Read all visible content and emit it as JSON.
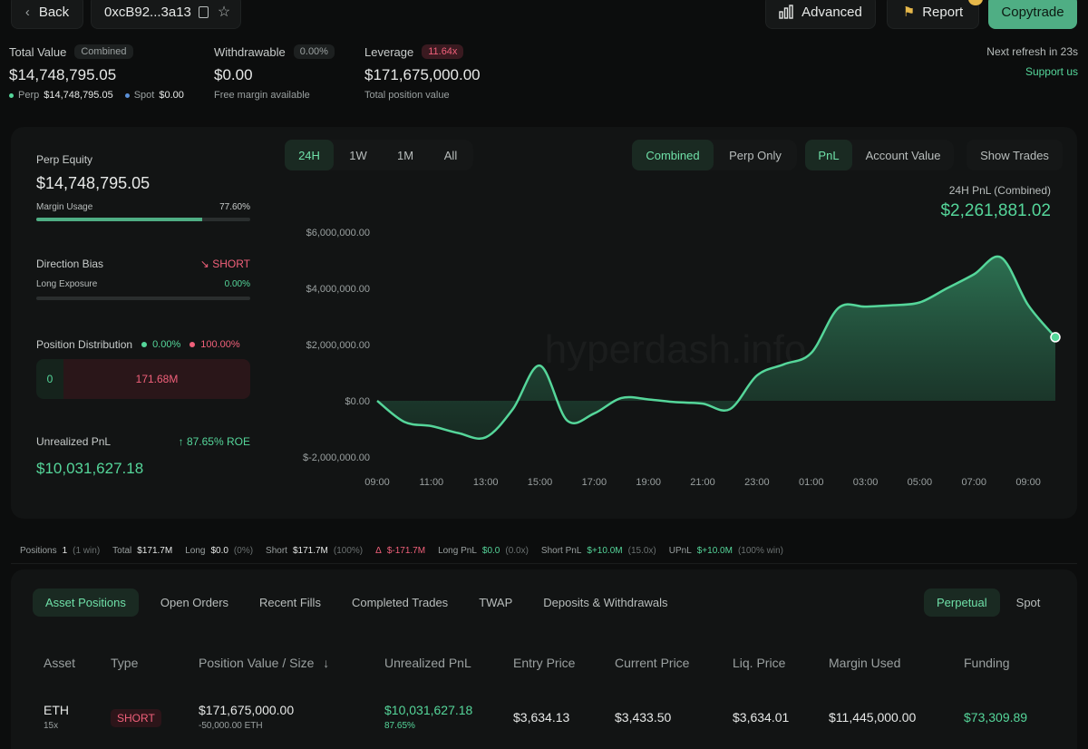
{
  "header": {
    "back_label": "Back",
    "address": "0xcB92...3a13",
    "advanced_label": "Advanced",
    "report_label": "Report",
    "copytrade_label": "Copytrade"
  },
  "summary": {
    "total_value_label": "Total Value",
    "total_value_badge": "Combined",
    "total_value": "$14,748,795.05",
    "perp_label": "Perp",
    "perp_value": "$14,748,795.05",
    "spot_label": "Spot",
    "spot_value": "$0.00",
    "withdrawable_label": "Withdrawable",
    "withdrawable_badge": "0.00%",
    "withdrawable_value": "$0.00",
    "withdrawable_sub": "Free margin available",
    "leverage_label": "Leverage",
    "leverage_badge": "11.64x",
    "leverage_value": "$171,675,000.00",
    "leverage_sub": "Total position value",
    "next_refresh": "Next refresh in 23s",
    "support": "Support us"
  },
  "left": {
    "perp_equity_label": "Perp Equity",
    "perp_equity_value": "$14,748,795.05",
    "margin_usage_label": "Margin Usage",
    "margin_usage_value": "77.60%",
    "margin_usage_fraction": 0.776,
    "direction_bias_label": "Direction Bias",
    "direction_bias_value": "SHORT",
    "long_exposure_label": "Long Exposure",
    "long_exposure_value": "0.00%",
    "long_exposure_fraction": 0.0,
    "position_distribution_label": "Position Distribution",
    "dist_long_pct": "0.00%",
    "dist_short_pct": "100.00%",
    "dist_long_value": "0",
    "dist_short_value": "171.68M",
    "unrealized_label": "Unrealized PnL",
    "roe": "87.65% ROE",
    "unrealized_value": "$10,031,627.18"
  },
  "chart_controls": {
    "ranges": [
      "24H",
      "1W",
      "1M",
      "All"
    ],
    "active_range": "24H",
    "modes": [
      "Combined",
      "Perp Only"
    ],
    "metrics": [
      "PnL",
      "Account Value"
    ],
    "show_trades": "Show Trades",
    "pnl_label": "24H PnL (Combined)",
    "pnl_value": "$2,261,881.02",
    "watermark": "hyperdash.info"
  },
  "chart_data": {
    "type": "area",
    "x": [
      "09:00",
      "10:00",
      "11:00",
      "12:00",
      "13:00",
      "14:00",
      "15:00",
      "16:00",
      "17:00",
      "18:00",
      "19:00",
      "20:00",
      "21:00",
      "22:00",
      "23:00",
      "00:00",
      "01:00",
      "02:00",
      "03:00",
      "04:00",
      "05:00",
      "06:00",
      "07:00",
      "08:00",
      "09:00",
      "10:00"
    ],
    "values": [
      0,
      -750000,
      -900000,
      -1150000,
      -1300000,
      -300000,
      1250000,
      -700000,
      -450000,
      100000,
      50000,
      -50000,
      -100000,
      -300000,
      900000,
      1300000,
      1700000,
      3300000,
      3350000,
      3400000,
      3500000,
      4000000,
      4500000,
      5100000,
      3400000,
      2261881
    ],
    "x_ticks": [
      "09:00",
      "11:00",
      "13:00",
      "15:00",
      "17:00",
      "19:00",
      "21:00",
      "23:00",
      "01:00",
      "03:00",
      "05:00",
      "07:00",
      "09:00"
    ],
    "y_ticks": [
      "$6,000,000.00",
      "$4,000,000.00",
      "$2,000,000.00",
      "$0.00",
      "$-2,000,000.00"
    ],
    "ylim": [
      -2000000,
      6000000
    ],
    "color": "#55d69a"
  },
  "stats_bar": {
    "positions_label": "Positions",
    "positions_value": "1",
    "positions_sub": "(1 win)",
    "total_label": "Total",
    "total_value": "$171.7M",
    "long_label": "Long",
    "long_value": "$0.0",
    "long_sub": "(0%)",
    "short_label": "Short",
    "short_value": "$171.7M",
    "short_sub": "(100%)",
    "delta_label": "Δ",
    "delta_value": "$-171.7M",
    "long_pnl_label": "Long PnL",
    "long_pnl_value": "$0.0",
    "long_pnl_sub": "(0.0x)",
    "short_pnl_label": "Short PnL",
    "short_pnl_value": "$+10.0M",
    "short_pnl_sub": "(15.0x)",
    "upnl_label": "UPnL",
    "upnl_value": "$+10.0M",
    "upnl_sub": "(100% win)"
  },
  "tabs": [
    "Asset Positions",
    "Open Orders",
    "Recent Fills",
    "Completed Trades",
    "TWAP",
    "Deposits & Withdrawals"
  ],
  "market_tabs": [
    "Perpetual",
    "Spot"
  ],
  "table": {
    "headers": [
      "Asset",
      "Type",
      "Position Value / Size",
      "Unrealized PnL",
      "Entry Price",
      "Current Price",
      "Liq. Price",
      "Margin Used",
      "Funding"
    ],
    "sort_icon": "↓",
    "row": {
      "asset": "ETH",
      "leverage": "15x",
      "type": "SHORT",
      "position_value": "$171,675,000.00",
      "position_size": "-50,000.00 ETH",
      "upnl": "$10,031,627.18",
      "upnl_pct": "87.65%",
      "entry": "$3,634.13",
      "current": "$3,433.50",
      "liq": "$3,634.01",
      "margin": "$11,445,000.00",
      "funding": "$73,309.89"
    }
  }
}
